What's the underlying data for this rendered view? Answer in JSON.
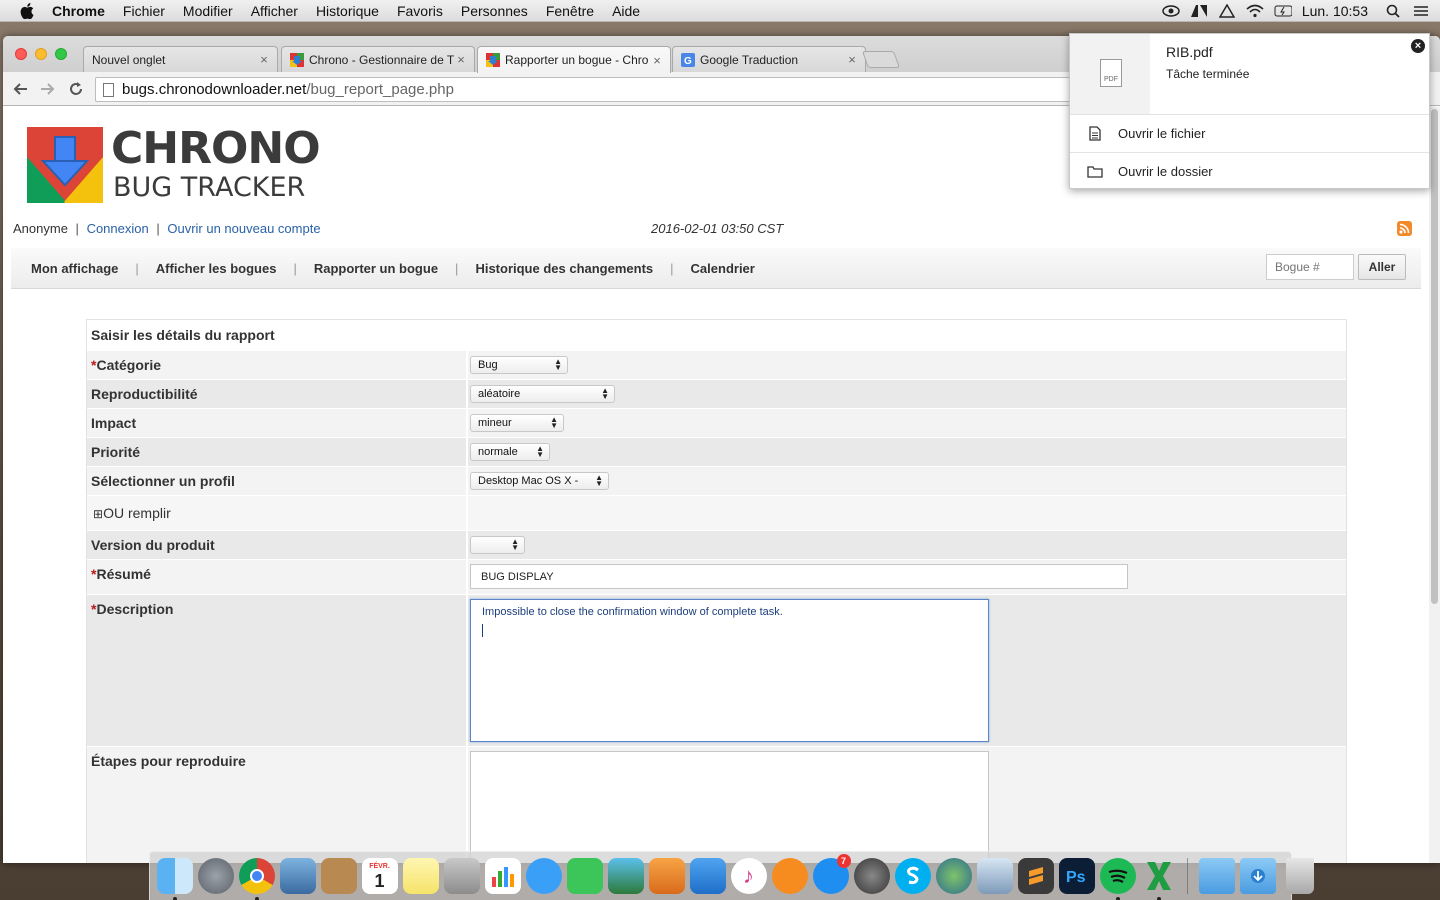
{
  "menubar": {
    "app": "Chrome",
    "items": [
      "Fichier",
      "Modifier",
      "Afficher",
      "Historique",
      "Favoris",
      "Personnes",
      "Fenêtre",
      "Aide"
    ],
    "clock": "Lun. 10:53"
  },
  "tabs": [
    {
      "title": "Nouvel onglet",
      "close": "×"
    },
    {
      "title": "Chrono - Gestionnaire de T",
      "close": "×"
    },
    {
      "title": "Rapporter un bogue - Chro",
      "close": "×"
    },
    {
      "title": "Google Traduction",
      "close": "×"
    }
  ],
  "address": {
    "host": "bugs.chronodownloader.net",
    "path": "/bug_report_page.php"
  },
  "logo": {
    "brand": "CHRONO",
    "sub": "BUG TRACKER"
  },
  "user": {
    "name": "Anonyme",
    "sep1": "|",
    "login": "Connexion",
    "sep2": "|",
    "signup": "Ouvrir un nouveau compte",
    "datetime": "2016-02-01 03:50 CST"
  },
  "nav": {
    "items": [
      "Mon affichage",
      "Afficher les bogues",
      "Rapporter un bogue",
      "Historique des changements",
      "Calendrier"
    ],
    "divider": "|",
    "bug_placeholder": "Bogue #",
    "go": "Aller"
  },
  "form": {
    "header": "Saisir les détails du rapport",
    "required_mark": "*",
    "category": {
      "label": "Catégorie",
      "value": "Bug"
    },
    "reproducibility": {
      "label": "Reproductibilité",
      "value": "aléatoire"
    },
    "impact": {
      "label": "Impact",
      "value": "mineur"
    },
    "priority": {
      "label": "Priorité",
      "value": "normale"
    },
    "profile": {
      "label": "Sélectionner un profil",
      "value": "Desktop Mac OS X -"
    },
    "or_fill": {
      "icon": "⊞",
      "label": "OU remplir"
    },
    "version": {
      "label": "Version du produit",
      "value": ""
    },
    "summary": {
      "label": "Résumé",
      "value": "BUG DISPLAY"
    },
    "description": {
      "label": "Description",
      "value": "Impossible to close the confirmation window of complete task."
    },
    "steps": {
      "label": "Étapes pour reproduire",
      "value": ""
    }
  },
  "download_popup": {
    "filename": "RIB.pdf",
    "status": "Tâche terminée",
    "file_badge": "PDF",
    "close": "×",
    "open_file": "Ouvrir le fichier",
    "open_folder": "Ouvrir le dossier"
  },
  "dock": {
    "apps": [
      "finder",
      "launchpad",
      "chrome",
      "preview",
      "contacts",
      "calendar",
      "notes",
      "photo-booth",
      "numbers",
      "messages",
      "facetime",
      "iphoto",
      "pages",
      "keynote",
      "itunes",
      "ibooks",
      "app-store",
      "system-preferences",
      "skype",
      "network-utility",
      "xcode-instruments",
      "sublime-text",
      "photoshop",
      "spotify",
      "excel"
    ],
    "calendar_month": "FÉVR.",
    "calendar_day": "1",
    "app_store_badge": "7",
    "folders": [
      "applications-folder",
      "downloads-folder",
      "trash"
    ]
  },
  "colors": {
    "link": "#2a62a8",
    "required": "#b51b1b",
    "rss": "#f28a2b"
  }
}
